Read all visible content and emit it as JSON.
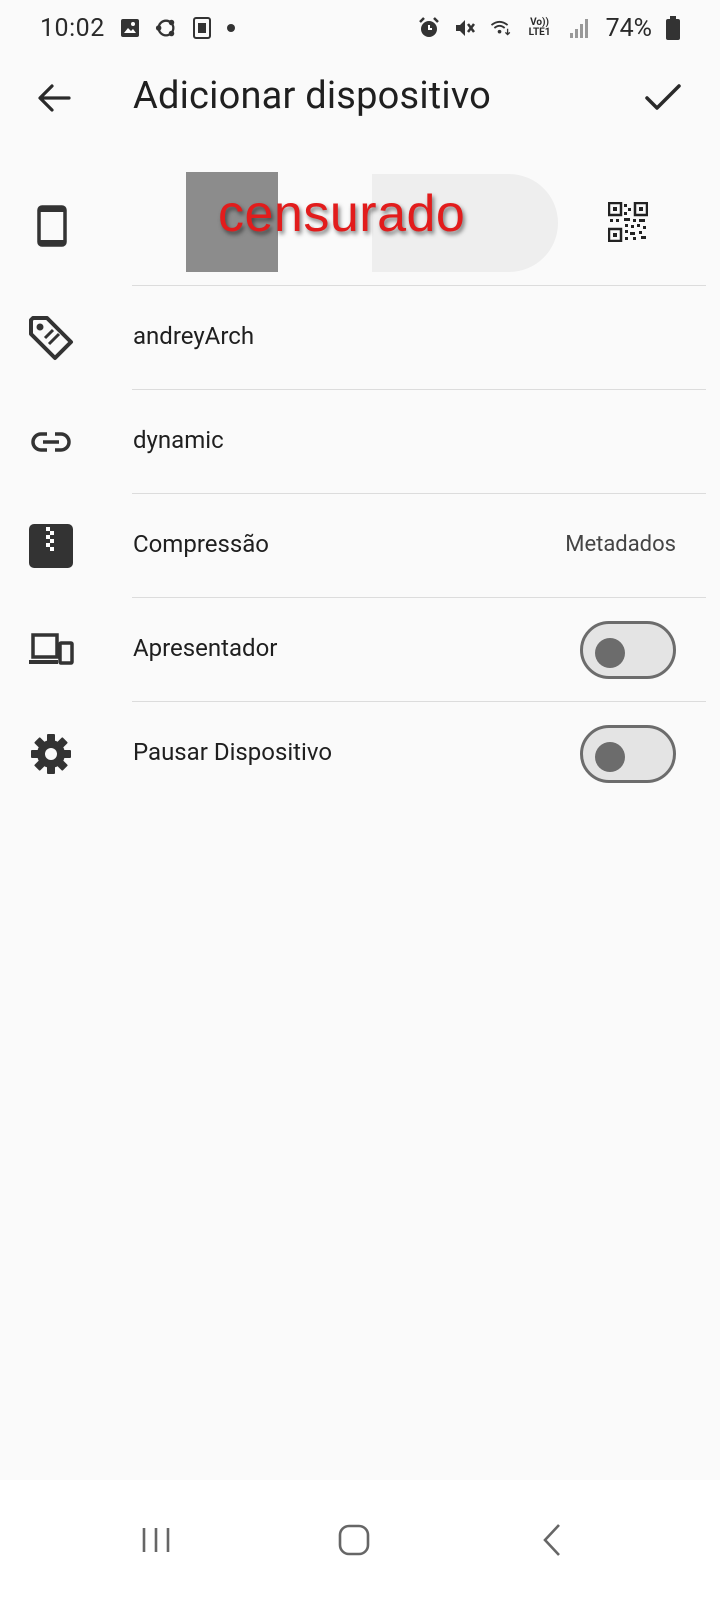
{
  "status_bar": {
    "time": "10:02",
    "battery": "74%",
    "volte_top": "Vo))",
    "volte_bottom": "LTE1"
  },
  "app_bar": {
    "title": "Adicionar dispositivo"
  },
  "device_id": {
    "redaction_text": "censurado"
  },
  "settings": {
    "name": {
      "label": "andreyArch",
      "icon": "tag-icon"
    },
    "address": {
      "label": "dynamic",
      "icon": "link-icon"
    },
    "compression": {
      "label": "Compressão",
      "value": "Metadados",
      "icon": "zip-icon"
    },
    "introducer": {
      "label": "Apresentador",
      "enabled": false,
      "icon": "devices-icon"
    },
    "pause": {
      "label": "Pausar Dispositivo",
      "enabled": false,
      "icon": "gear-icon"
    }
  },
  "colors": {
    "background": "#fafafa",
    "divider": "#dcdcdc",
    "toggle_track": "#e4e4e4",
    "toggle_knob": "#6c6c6c",
    "redaction_text": "#e21c1c"
  }
}
